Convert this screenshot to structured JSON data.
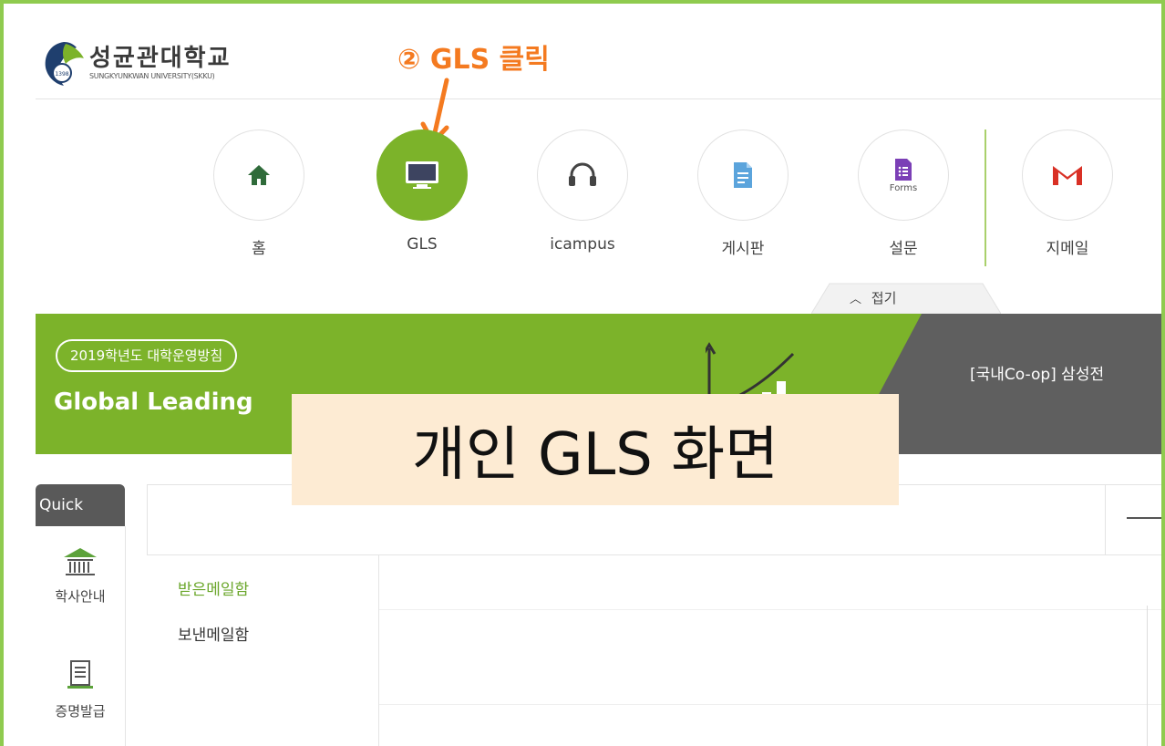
{
  "header": {
    "logo_korean": "성균관대학교",
    "logo_english": "SUNGKYUNKWAN UNIVERSITY(SKKU)",
    "logo_year": "1398"
  },
  "annotation": {
    "step_text": "② GLS 클릭",
    "color": "#f47a20"
  },
  "nav": {
    "items": [
      {
        "label": "홈",
        "icon": "home-icon"
      },
      {
        "label": "GLS",
        "icon": "monitor-icon",
        "active": true
      },
      {
        "label": "icampus",
        "icon": "headset-icon"
      },
      {
        "label": "게시판",
        "icon": "document-icon"
      },
      {
        "label": "설문",
        "icon": "forms-icon",
        "caption": "Forms"
      },
      {
        "label": "지메일",
        "icon": "gmail-icon"
      }
    ],
    "fold_label": "접기"
  },
  "banner": {
    "pill": "2019학년도 대학운영방침",
    "title": "Global Leading",
    "right_text": "[국내Co-op] 삼성전",
    "accent": "#7cb32a"
  },
  "overlay": {
    "caption": "개인 GLS 화면"
  },
  "quick": {
    "tab_label": "Quick",
    "items": [
      {
        "label": "학사안내",
        "icon": "university-icon"
      },
      {
        "label": "증명발급",
        "icon": "certificate-icon"
      }
    ]
  },
  "mail_menu": {
    "items": [
      {
        "label": "받은메일함",
        "active": true
      },
      {
        "label": "보낸메일함",
        "active": false
      }
    ]
  }
}
